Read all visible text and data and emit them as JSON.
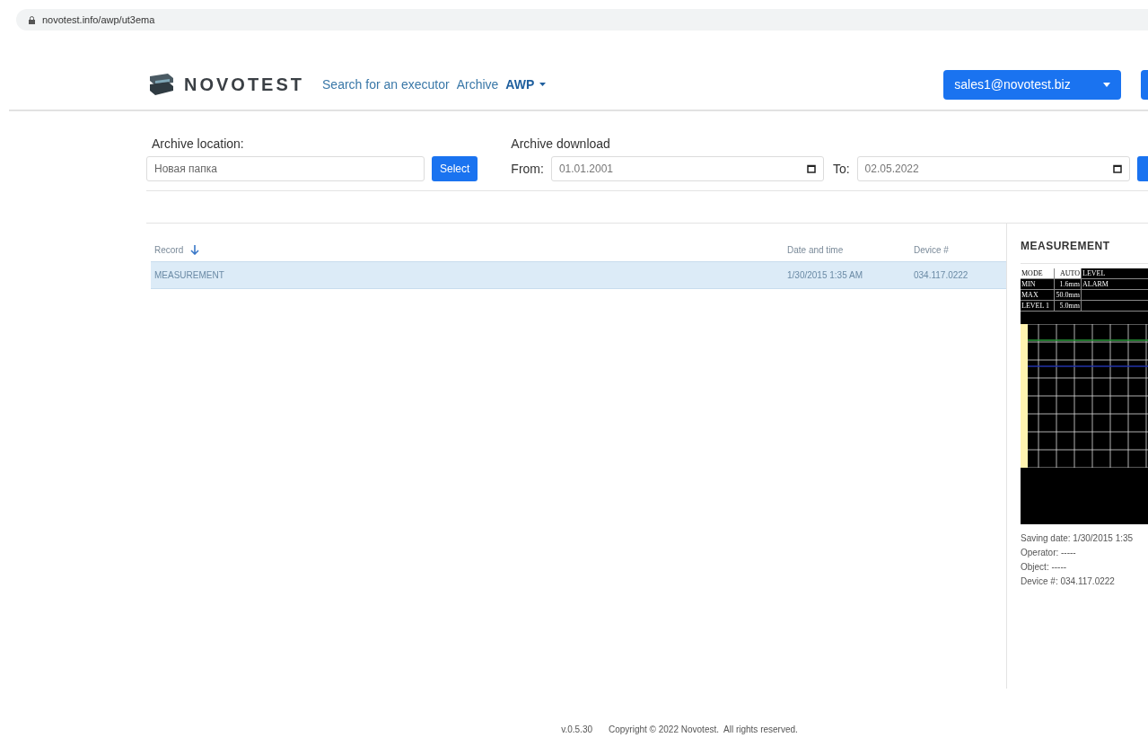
{
  "address_bar": {
    "url": "novotest.info/awp/ut3ema"
  },
  "header": {
    "logo": "NOVOTEST",
    "nav": [
      {
        "label": "Search for an executor",
        "kind": "link"
      },
      {
        "label": "Archive",
        "kind": "link"
      },
      {
        "label": "AWP",
        "kind": "dropdown"
      }
    ],
    "user_button": "sales1@novotest.biz"
  },
  "filters": {
    "location_label": "Archive location:",
    "location_value": "Новая папка",
    "select_button": "Select",
    "download_label": "Archive download",
    "from_label": "From:",
    "from_value": "01.01.2001",
    "to_label": "To:",
    "to_value": "02.05.2022"
  },
  "table": {
    "columns": [
      {
        "label": "Record",
        "sorted": true
      },
      {
        "label": "Date and time",
        "sorted": false
      },
      {
        "label": "Device #",
        "sorted": false
      }
    ],
    "rows": [
      {
        "cells": [
          "MEASUREMENT",
          "1/30/2015 1:35 AM",
          "034.117.0222"
        ],
        "selected": true
      }
    ]
  },
  "detail": {
    "title": "MEASUREMENT",
    "device_screen": {
      "rows": [
        {
          "cells": [
            "MODE",
            "AUTO",
            "LEVEL"
          ],
          "highlighted": true
        },
        {
          "cells": [
            "MIN",
            "1.6mm",
            "ALARM"
          ],
          "highlighted": false
        },
        {
          "cells": [
            "MAX",
            "50.0mm",
            ""
          ],
          "highlighted": false
        },
        {
          "cells": [
            "LEVEL 1",
            "5.0mm",
            ""
          ],
          "highlighted": false
        }
      ]
    },
    "info": [
      "Saving date: 1/30/2015 1:35",
      "Operator: -----",
      "Object: -----",
      "Device #: 034.117.0222"
    ]
  },
  "footer": {
    "version": "v.0.5.30",
    "copyright": "Copyright © 2022 Novotest.  All rights reserved."
  }
}
